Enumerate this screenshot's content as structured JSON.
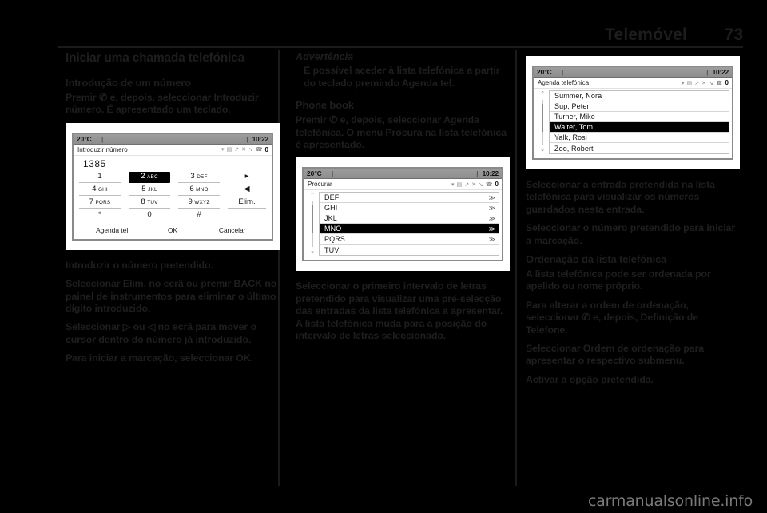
{
  "header": {
    "title": "Telemóvel",
    "page_number": "73"
  },
  "column1": {
    "heading": "Iniciar uma chamada telefónica",
    "subheading": "Introdução de um número",
    "intro_paragraph": "Premir ✆ e, depois, seleccionar Introduzir número. É apresentado um teclado.",
    "paragraphs": [
      "Introduzir o número pretendido.",
      "Seleccionar Elim. no ecrã ou premir BACK no painel de instrumentos para eliminar o último dígito introduzido.",
      "Seleccionar ▷ ou ◁ no ecrã para mover o cursor dentro do número já introduzido.",
      "Para iniciar a marcação, seleccionar OK."
    ],
    "screenshot": {
      "statusbar": {
        "temperature": "20°C",
        "separator": "|",
        "time": "10:22"
      },
      "title": "Introduzir número",
      "status_icons": [
        "wifi-icon",
        "envelope-icon",
        "mute-icon",
        "shuffle-icon",
        "speaker-off-icon",
        "phone-icon",
        "battery-icon"
      ],
      "entry_value": "1385",
      "keys": [
        {
          "digit": "1",
          "letters": "",
          "selected": false
        },
        {
          "digit": "2",
          "letters": "ABC",
          "selected": true
        },
        {
          "digit": "3",
          "letters": "DEF",
          "selected": false
        },
        {
          "digit": "▸",
          "letters": "",
          "selected": false,
          "nounderline": true
        },
        {
          "digit": "4",
          "letters": "GHI",
          "selected": false
        },
        {
          "digit": "5",
          "letters": "JKL",
          "selected": false
        },
        {
          "digit": "6",
          "letters": "MNO",
          "selected": false
        },
        {
          "digit": "◀",
          "letters": "",
          "selected": false,
          "nounderline": true
        },
        {
          "digit": "7",
          "letters": "PQRS",
          "selected": false
        },
        {
          "digit": "8",
          "letters": "TUV",
          "selected": false
        },
        {
          "digit": "9",
          "letters": "WXYZ",
          "selected": false
        },
        {
          "digit": "Elim.",
          "letters": "",
          "selected": false
        },
        {
          "digit": "*",
          "letters": "",
          "selected": false
        },
        {
          "digit": "0",
          "letters": "",
          "selected": false
        },
        {
          "digit": "#",
          "letters": "",
          "selected": false
        },
        {
          "digit": "",
          "letters": "",
          "selected": false,
          "nounderline": true
        }
      ],
      "actions": [
        "Agenda tel.",
        "OK",
        "Cancelar"
      ]
    }
  },
  "column2": {
    "note_title": "Advertência",
    "note_body": "É possível aceder à lista telefónica a partir do teclado premindo Agenda tel.",
    "subheading": "Phone book",
    "intro_paragraph": "Premir ✆ e, depois, seleccionar Agenda telefónica. O menu Procura na lista telefónica é apresentado.",
    "paragraphs": [
      "Seleccionar o primeiro intervalo de letras pretendido para visualizar uma pré-selecção das entradas da lista telefónica a apresentar. A lista telefónica muda para a posição do intervalo de letras seleccionado."
    ],
    "screenshot": {
      "statusbar": {
        "temperature": "20°C",
        "separator": "|",
        "time": "10:22"
      },
      "title": "Procurar",
      "status_icons": [
        "wifi-icon",
        "envelope-icon",
        "mute-icon",
        "shuffle-icon",
        "speaker-off-icon",
        "phone-icon",
        "battery-icon"
      ],
      "rows": [
        {
          "label": "DEF",
          "chevron": "≫",
          "selected": false
        },
        {
          "label": "GHI",
          "chevron": "≫",
          "selected": false
        },
        {
          "label": "JKL",
          "chevron": "≫",
          "selected": false
        },
        {
          "label": "MNO",
          "chevron": "≫",
          "selected": true
        },
        {
          "label": "PQRS",
          "chevron": "≫",
          "selected": false
        },
        {
          "label": "TUV",
          "chevron": "",
          "selected": false
        }
      ],
      "scroll_up": "⌃",
      "scroll_down": "⌄"
    }
  },
  "column3": {
    "screenshot": {
      "statusbar": {
        "temperature": "20°C",
        "separator": "|",
        "time": "10:22"
      },
      "title": "Agenda telefónica",
      "status_icons": [
        "wifi-icon",
        "envelope-icon",
        "mute-icon",
        "shuffle-icon",
        "speaker-off-icon",
        "phone-icon",
        "battery-icon"
      ],
      "rows": [
        {
          "label": "Summer, Nora",
          "chevron": "",
          "selected": false
        },
        {
          "label": "Sup, Peter",
          "chevron": "",
          "selected": false
        },
        {
          "label": "Turner, Mike",
          "chevron": "",
          "selected": false
        },
        {
          "label": "Walter, Tom",
          "chevron": "",
          "selected": true
        },
        {
          "label": "Yalk, Rosi",
          "chevron": "",
          "selected": false
        },
        {
          "label": "Zoo, Robert",
          "chevron": "",
          "selected": false
        }
      ],
      "scroll_up": "⌃",
      "scroll_down": "⌄"
    },
    "paragraphs_top": [
      "Seleccionar a entrada pretendida na lista telefónica para visualizar os números guardados nesta entrada.",
      "Seleccionar o número pretendido para iniciar a marcação."
    ],
    "subheading": "Ordenação da lista telefónica",
    "paragraphs_bottom": [
      "A lista telefónica pode ser ordenada por apelido ou nome próprio.",
      "Para alterar a ordem de ordenação, seleccionar ✆ e, depois, Definição de Telefone.",
      "Seleccionar Ordem de ordenação para apresentar o respectivo submenu.",
      "Activar a opção pretendida."
    ]
  },
  "footer": {
    "watermark": "carmanualsonline.info"
  }
}
